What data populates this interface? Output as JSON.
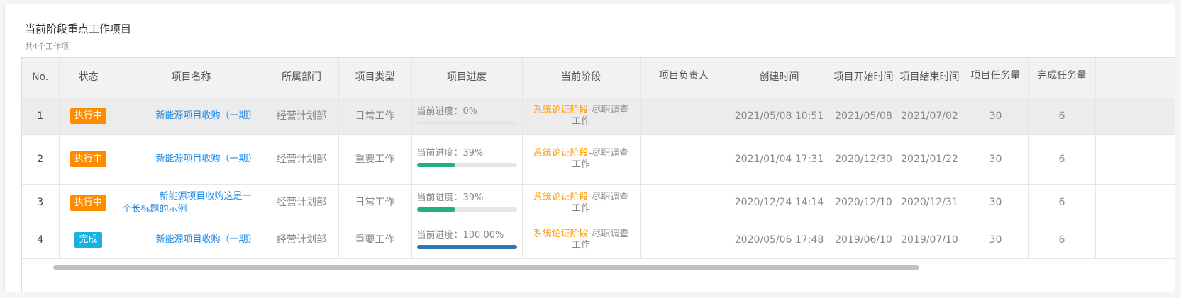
{
  "panel": {
    "title": "当前阶段重点工作项目",
    "subtitle": "共4个工作项"
  },
  "table": {
    "columns": [
      "No.",
      "状态",
      "项目名称",
      "所属部门",
      "项目类型",
      "项目进度",
      "当前阶段",
      "项目负责人",
      "创建时间",
      "项目开始时间",
      "项目结束时间",
      "项目任务量",
      "完成任务量"
    ],
    "progress_prefix": "当前进度：",
    "rows": [
      {
        "no": "1",
        "status": "执行中",
        "name": "新能源项目收购（一期）",
        "dept": "经营计划部",
        "type": "日常工作",
        "progress_label": "0%",
        "progress_value": 0,
        "stage_main": "系统论证阶段",
        "stage_sub": "-尽职调查工作",
        "owner": "",
        "created": "2021/05/08 10:51",
        "start": "2021/05/08",
        "end": "2021/07/02",
        "tasks": "30",
        "done": "6"
      },
      {
        "no": "2",
        "status": "执行中",
        "name": "新能源项目收购（一期）",
        "dept": "经营计划部",
        "type": "重要工作",
        "progress_label": "39%",
        "progress_value": 39,
        "stage_main": "系统论证阶段",
        "stage_sub": "-尽职调查工作",
        "owner": "",
        "created": "2021/01/04 17:31",
        "start": "2020/12/30",
        "end": "2021/01/22",
        "tasks": "30",
        "done": "6"
      },
      {
        "no": "3",
        "status": "执行中",
        "name": "新能源项目收购这是一个长标题的示例",
        "dept": "经营计划部",
        "type": "日常工作",
        "progress_label": "39%",
        "progress_value": 39,
        "stage_main": "系统论证阶段",
        "stage_sub": "-尽职调查工作",
        "owner": "",
        "created": "2020/12/24 14:14",
        "start": "2020/12/10",
        "end": "2020/12/31",
        "tasks": "30",
        "done": "6"
      },
      {
        "no": "4",
        "status": "完成",
        "name": "新能源项目收购（一期）",
        "dept": "经营计划部",
        "type": "重要工作",
        "progress_label": "100.00%",
        "progress_value": 100,
        "stage_main": "系统论证阶段",
        "stage_sub": "-尽职调查工作",
        "owner": "",
        "created": "2020/05/06 17:48",
        "start": "2019/06/10",
        "end": "2019/07/10",
        "tasks": "30",
        "done": "6"
      }
    ]
  },
  "colors": {
    "running": "#ff8c00",
    "done": "#1ab0e0",
    "progress_partial": "#22b07d",
    "progress_full": "#2e75b6",
    "stage_accent": "#ff9800",
    "link": "#1e88e5"
  }
}
